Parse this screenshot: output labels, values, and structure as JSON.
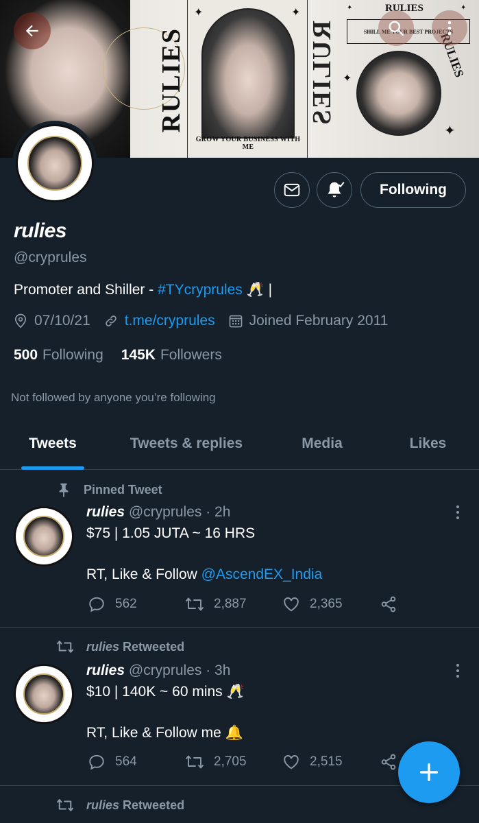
{
  "banner": {
    "left_vertical": "RULIES",
    "right_vertical": "RULIES",
    "top_right": "RULIES",
    "shill": "SHILL ME YOUR BEST PROJECTS",
    "grow": "GROW YOUR BUSINESS WITH ME",
    "curve": "RULIES"
  },
  "header": {
    "back_icon": "arrow-left-icon",
    "search_icon": "search-icon",
    "more_icon": "more-vertical-icon"
  },
  "profile": {
    "name": "rulies",
    "handle": "@cryprules",
    "bio_text": "Promoter and Shiller - ",
    "bio_tag": "#TYcryprules",
    "bio_suffix": " 🥂 |",
    "location": "07/10/21",
    "link": "t.me/cryprules",
    "joined": "Joined February 2011",
    "following_count": "500",
    "following_label": "Following",
    "followers_count": "145K",
    "followers_label": "Followers",
    "not_followed": "Not followed by anyone you’re following",
    "follow_button": "Following"
  },
  "tabs": [
    "Tweets",
    "Tweets & replies",
    "Media",
    "Likes"
  ],
  "tweets": [
    {
      "context": "Pinned Tweet",
      "name": "rulies",
      "handle": "@cryprules",
      "time": "· 2h",
      "line1": "$75 | 1.05 JUTA ~ 16 HRS",
      "line2_prefix": "RT, Like & Follow ",
      "mention": "@AscendEX_India",
      "replies": "562",
      "retweets": "2,887",
      "likes": "2,365"
    },
    {
      "context_name": "rulies",
      "context": "Retweeted",
      "name": "rulies",
      "handle": "@cryprules",
      "time": "· 3h",
      "line1": "$10 | 140K ~ 60 mins 🥂",
      "line2": "RT, Like & Follow me 🔔",
      "replies": "564",
      "retweets": "2,705",
      "likes": "2,515"
    },
    {
      "context_name": "rulies",
      "context": "Retweeted"
    }
  ],
  "colors": {
    "background": "#15202b",
    "accent": "#1d9bf0",
    "muted": "#8b98a5",
    "border": "#38444d"
  }
}
